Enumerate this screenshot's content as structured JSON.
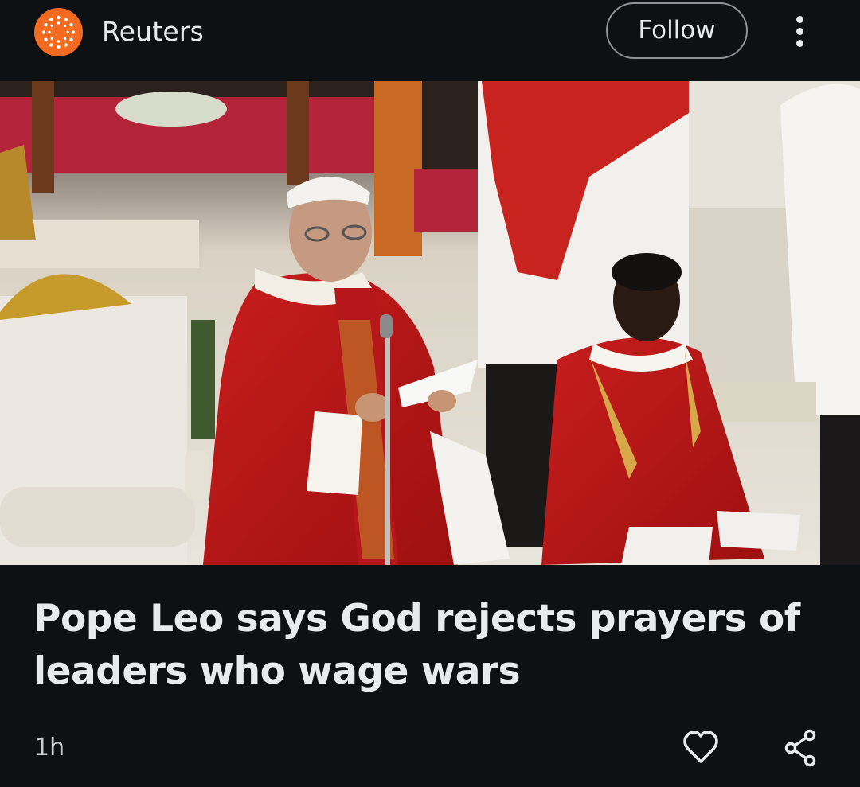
{
  "header": {
    "source_name": "Reuters",
    "logo_icon": "reuters-logo-icon",
    "follow_label": "Follow",
    "menu_icon": "more-vert-icon",
    "logo_color": "#f36b21"
  },
  "article": {
    "image_alt": "Pope Leo in red vestments speaking at a microphone beside a seated deacon",
    "headline": "Pope Leo says God rejects prayers of leaders who wage wars",
    "time_ago": "1h",
    "like_icon": "heart-icon",
    "share_icon": "share-icon"
  },
  "colors": {
    "background": "#0e1114",
    "text": "#e8eaed",
    "button_border": "#8d9399"
  }
}
